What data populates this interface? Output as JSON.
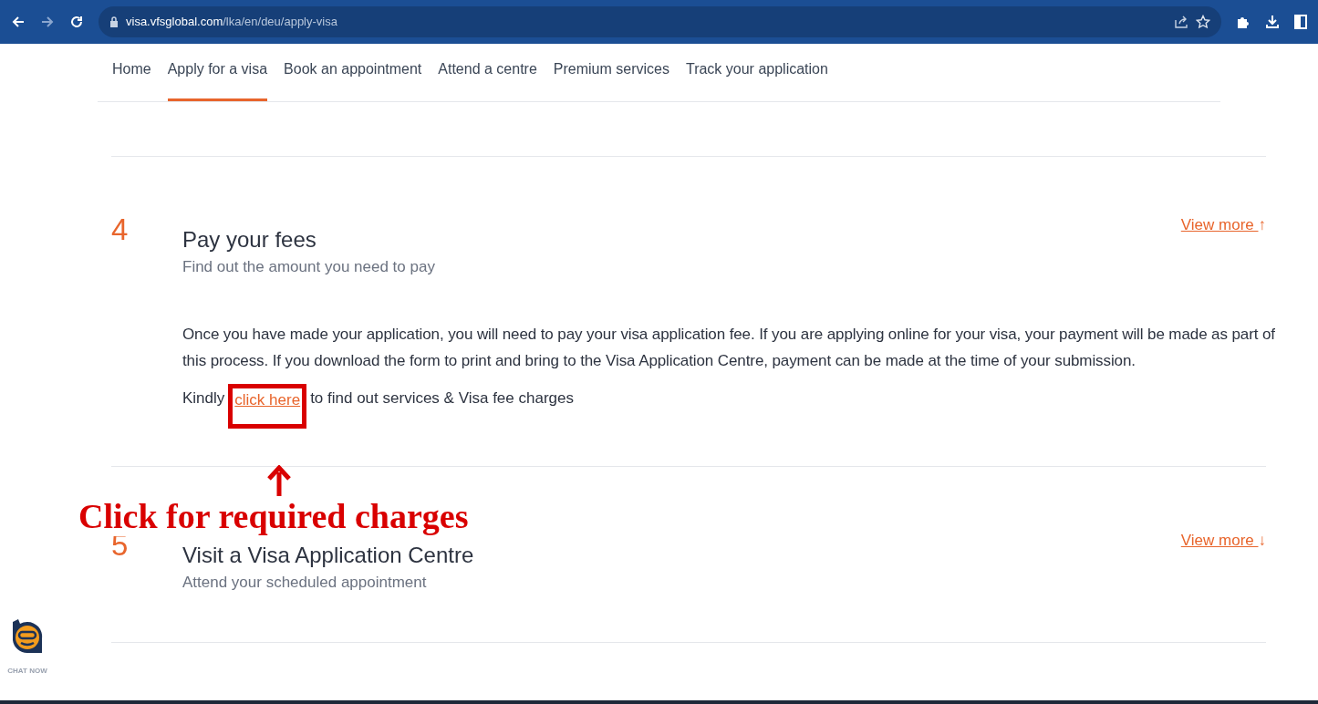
{
  "browser": {
    "url_host": "visa.vfsglobal.com",
    "url_path": "/lka/en/deu/apply-visa"
  },
  "nav": [
    {
      "label": "Home",
      "selected": false
    },
    {
      "label": "Apply for a visa",
      "selected": true
    },
    {
      "label": "Book an appointment",
      "selected": false
    },
    {
      "label": "Attend a centre",
      "selected": false
    },
    {
      "label": "Premium services",
      "selected": false
    },
    {
      "label": "Track your application",
      "selected": false
    }
  ],
  "steps": [
    {
      "number": "4",
      "title": "Pay your fees",
      "subtitle": "Find out the amount you need to pay",
      "view_more": "View more",
      "arrow": "↑",
      "body": "Once you have made your application, you will need to pay your visa application fee. If you are applying online for your visa, your payment will be made as part of this process. If you download the form to print and bring to the Visa Application Centre, payment can be made at the time of your submission.",
      "link_line": {
        "before": "Kindly",
        "link": "click here",
        "after": "to find out services & Visa fee charges"
      }
    },
    {
      "number": "5",
      "title": "Visit a Visa Application Centre",
      "subtitle": "Attend your scheduled appointment",
      "view_more": "View more",
      "arrow": "↓"
    }
  ],
  "annotation": "Click for required charges",
  "chat": {
    "label": "CHAT NOW"
  }
}
